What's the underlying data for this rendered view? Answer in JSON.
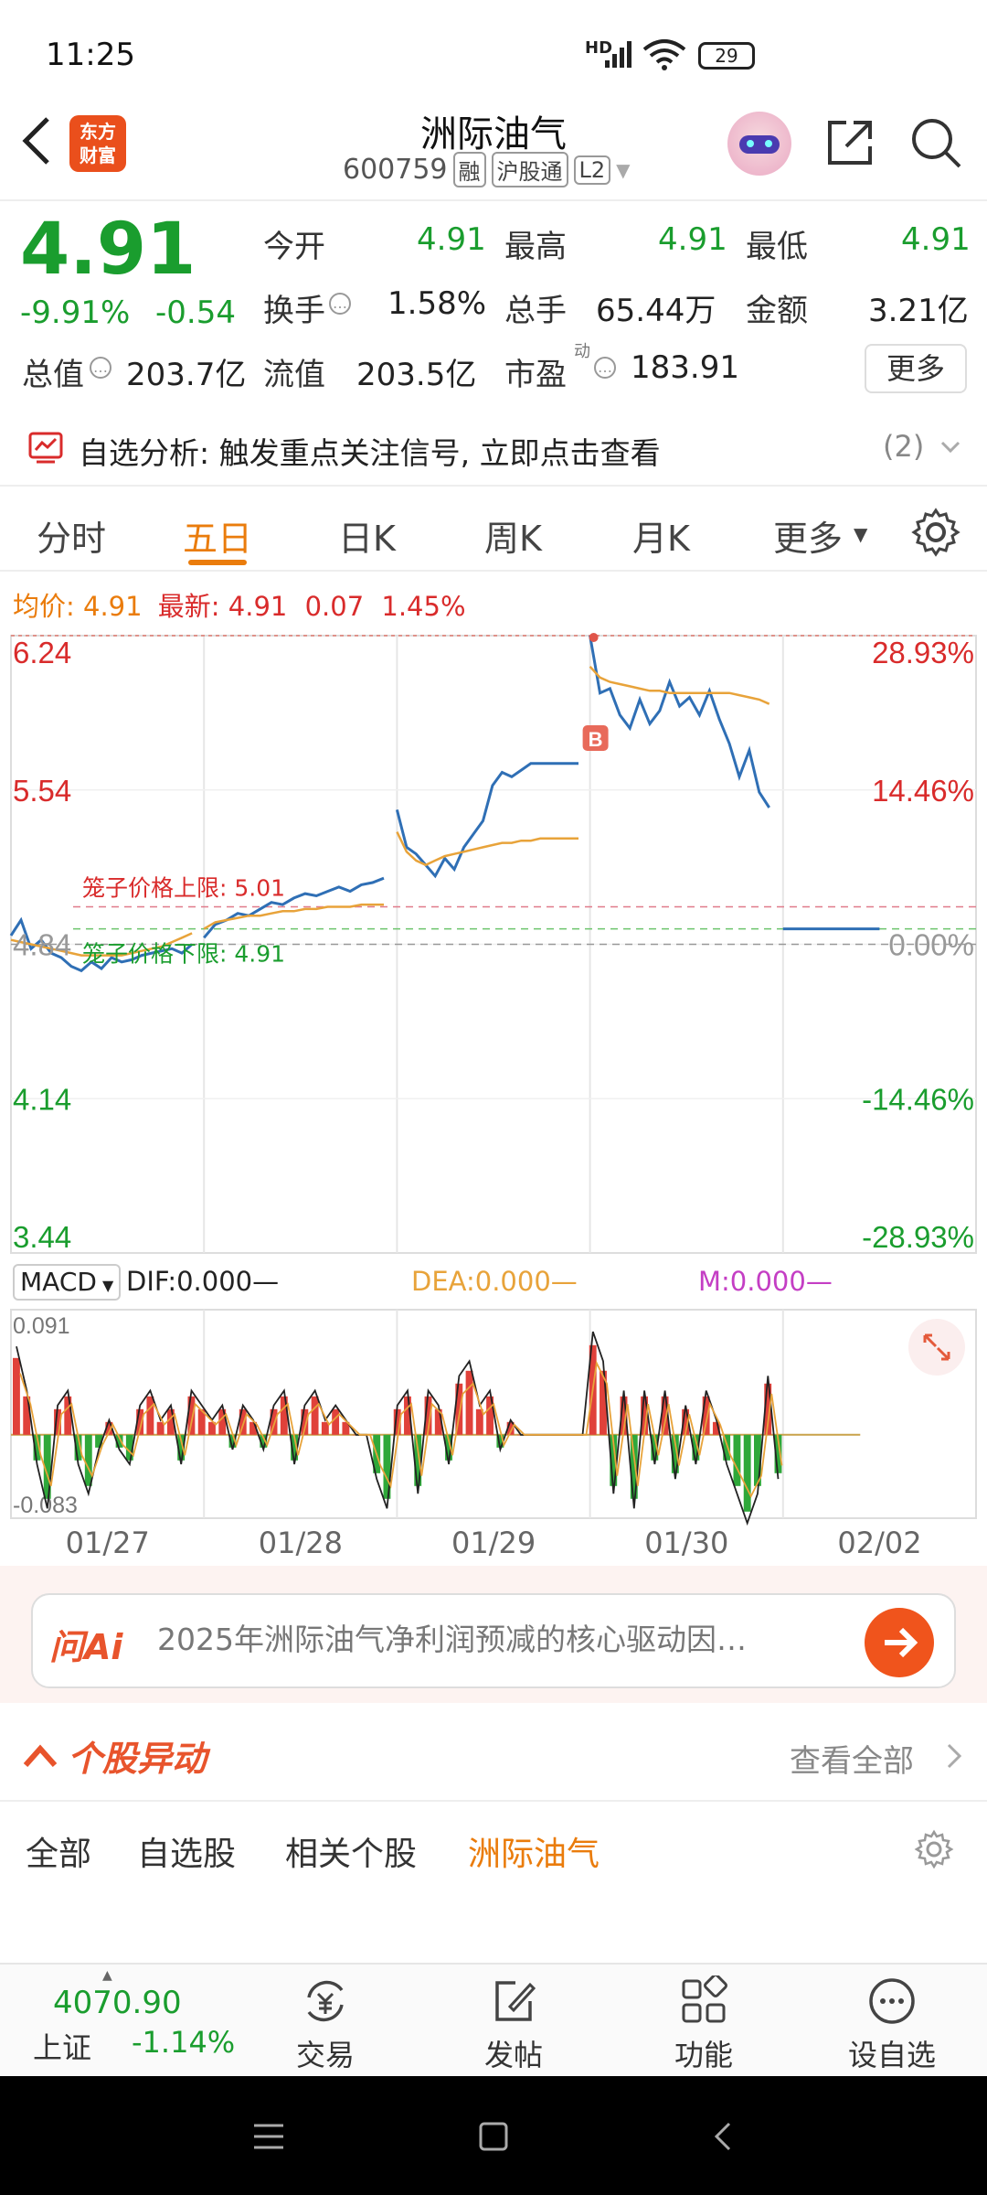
{
  "status": {
    "time": "11:25",
    "battery": "29",
    "network": "HD"
  },
  "header": {
    "back_icon": "chevron-left-icon",
    "logo_text_1": "东方",
    "logo_text_2": "财富",
    "title": "洲际油气",
    "code": "600759",
    "tag_rong": "融",
    "tag_hgt": "沪股通",
    "tag_l2": "L2"
  },
  "quote": {
    "price": "4.91",
    "change_pct": "-9.91%",
    "change_amt": "-0.54",
    "open_label": "今开",
    "open": "4.91",
    "high_label": "最高",
    "high": "4.91",
    "low_label": "最低",
    "low": "4.91",
    "turnover_label": "换手",
    "turnover": "1.58%",
    "volume_label": "总手",
    "volume": "65.44万",
    "amount_label": "金额",
    "amount": "3.21亿",
    "mcap_label": "总值",
    "mcap": "203.7亿",
    "float_label": "流值",
    "float": "203.5亿",
    "pe_label": "市盈",
    "pe_sup": "动",
    "pe": "183.91",
    "more_button": "更多"
  },
  "alert": {
    "text": "自选分析: 触发重点关注信号, 立即点击查看",
    "count": "(2)"
  },
  "tabs": {
    "items": [
      "分时",
      "五日",
      "日K",
      "周K",
      "月K",
      "更多"
    ],
    "active": "五日"
  },
  "chart_info": {
    "avg_label": "均价:",
    "avg": "4.91",
    "latest_label": "最新:",
    "latest": "4.91",
    "chg": "0.07",
    "chg_pct": "1.45%"
  },
  "chart_data": {
    "type": "line",
    "y_ticks_left": [
      "6.24",
      "5.54",
      "4.84",
      "4.14",
      "3.44"
    ],
    "y_ticks_right": [
      "28.93%",
      "14.46%",
      "0.00%",
      "-14.46%",
      "-28.93%"
    ],
    "ylim": [
      3.44,
      6.24
    ],
    "limit_up_label": "笼子价格上限: 5.01",
    "limit_down_label": "笼子价格下限: 4.91",
    "limit_up": 5.01,
    "limit_down": 4.91,
    "prev_close": 4.84,
    "x_labels": [
      "01/27",
      "01/28",
      "01/29",
      "01/30",
      "02/02"
    ],
    "series": [
      {
        "values": [
          4.88,
          4.95,
          4.82,
          4.86,
          4.8,
          4.78,
          4.74,
          4.72,
          4.76,
          4.73,
          4.78,
          4.76,
          4.77,
          4.79,
          4.8,
          4.81,
          4.82,
          4.8,
          4.84,
          4.87,
          4.93,
          4.95,
          4.98,
          4.97,
          5.0,
          5.03,
          5.02,
          5.05,
          5.07,
          5.06,
          5.08,
          5.1,
          5.08,
          5.11,
          5.12,
          5.14,
          5.45,
          5.28,
          5.25,
          5.2,
          5.15,
          5.23,
          5.18,
          5.28,
          5.34,
          5.4,
          5.56,
          5.62,
          5.6,
          5.63,
          5.66,
          5.66,
          5.66,
          5.66,
          5.66,
          5.66,
          6.24,
          5.98,
          6.0,
          5.88,
          5.82,
          5.95,
          5.84,
          5.9,
          6.03,
          5.92,
          5.96,
          5.88,
          5.99,
          5.86,
          5.75,
          5.6,
          5.72,
          5.53,
          5.46
        ]
      },
      {
        "values": [
          4.86,
          4.85,
          4.84,
          4.83,
          4.82,
          4.81,
          4.8,
          4.79,
          4.79,
          4.79,
          4.79,
          4.79,
          4.8,
          4.81,
          4.82,
          4.83,
          4.85,
          4.87,
          4.89,
          4.91,
          4.94,
          4.95,
          4.96,
          4.97,
          4.97,
          4.98,
          4.99,
          4.99,
          5.0,
          5.0,
          5.01,
          5.01,
          5.01,
          5.02,
          5.02,
          5.02,
          5.35,
          5.26,
          5.22,
          5.2,
          5.22,
          5.24,
          5.25,
          5.26,
          5.27,
          5.28,
          5.29,
          5.3,
          5.3,
          5.31,
          5.31,
          5.32,
          5.32,
          5.32,
          5.32,
          5.32,
          6.1,
          6.05,
          6.03,
          6.02,
          6.01,
          6.0,
          5.99,
          5.99,
          5.98,
          5.98,
          5.98,
          5.98,
          5.98,
          5.98,
          5.98,
          5.97,
          5.96,
          5.95,
          5.93
        ]
      }
    ]
  },
  "macd": {
    "selector": "MACD",
    "dif": "DIF:0.000—",
    "dea": "DEA:0.000—",
    "m": "M:0.000—",
    "max": "0.091",
    "min": "-0.083",
    "bars": [
      0.06,
      0.03,
      -0.02,
      -0.05,
      0.02,
      0.03,
      -0.02,
      -0.04,
      -0.01,
      0.01,
      -0.01,
      -0.02,
      0.02,
      0.03,
      0.01,
      0.02,
      -0.02,
      0.03,
      0.02,
      0.01,
      0.02,
      -0.01,
      0.02,
      0.01,
      -0.01,
      0.02,
      0.03,
      -0.02,
      0.02,
      0.03,
      0.01,
      0.02,
      0.01,
      0.0,
      0.0,
      -0.03,
      -0.05,
      0.02,
      0.03,
      -0.04,
      0.03,
      0.02,
      -0.02,
      0.04,
      0.05,
      0.02,
      0.03,
      -0.01,
      0.01,
      0.0,
      0.0,
      0.0,
      0.0,
      0.0,
      0.0,
      0.0,
      0.07,
      0.05,
      -0.04,
      0.03,
      -0.05,
      0.03,
      -0.02,
      0.03,
      -0.03,
      0.02,
      -0.02,
      0.03,
      0.01,
      -0.02,
      -0.04,
      -0.06,
      -0.04,
      0.04,
      -0.03
    ]
  },
  "ai": {
    "logo": "问Ai",
    "text": "2025年洲际油气净利润预减的核心驱动因…"
  },
  "section": {
    "title": "个股异动",
    "view_all": "查看全部"
  },
  "subtabs": {
    "items": [
      "全部",
      "自选股",
      "相关个股",
      "洲际油气"
    ],
    "active": "洲际油气"
  },
  "bottom": {
    "index_value": "4070.90",
    "index_name": "上证",
    "index_change": "-1.14%",
    "items": [
      "交易",
      "发帖",
      "功能",
      "设自选"
    ]
  },
  "colors": {
    "up": "#d92b2b",
    "down": "#1a9d2e",
    "line": "#2f6fb5",
    "avg": "#e8a33a",
    "accent": "#ea7c0c"
  }
}
